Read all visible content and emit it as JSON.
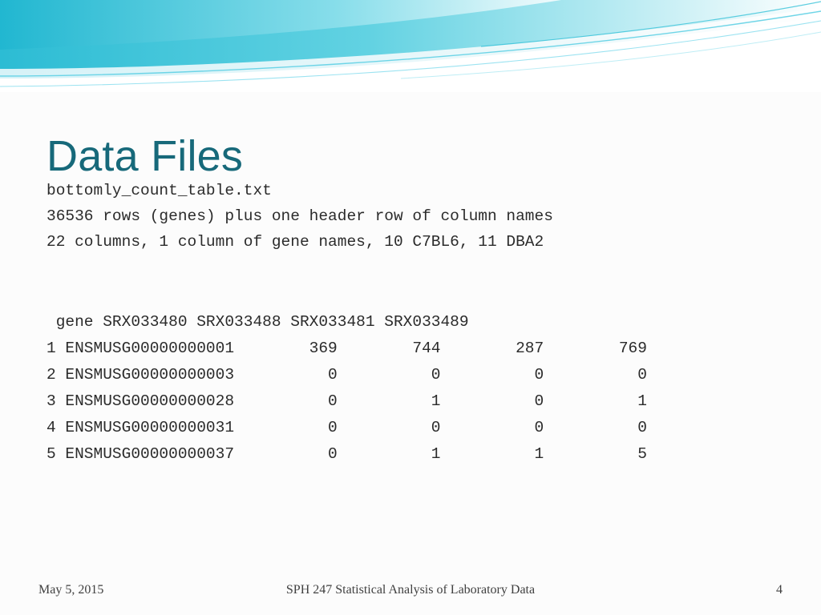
{
  "slide": {
    "title": "Data Files",
    "description_lines": [
      "bottomly_count_table.txt",
      "36536 rows (genes) plus one header row of column names",
      "22 columns, 1 column of gene names, 10 C7BL6, 11 DBA2"
    ],
    "table_text": " gene SRX033480 SRX033488 SRX033481 SRX033489\n1 ENSMUSG00000000001        369        744        287        769\n2 ENSMUSG00000000003          0          0          0          0\n3 ENSMUSG00000000028          0          1          0          1\n4 ENSMUSG00000000031          0          0          0          0\n5 ENSMUSG00000000037          0          1          1          5",
    "table": {
      "columns": [
        "gene",
        "SRX033480",
        "SRX033488",
        "SRX033481",
        "SRX033489"
      ],
      "rows": [
        {
          "index": "1",
          "gene": "ENSMUSG00000000001",
          "values": [
            "369",
            "744",
            "287",
            "769"
          ]
        },
        {
          "index": "2",
          "gene": "ENSMUSG00000000003",
          "values": [
            "0",
            "0",
            "0",
            "0"
          ]
        },
        {
          "index": "3",
          "gene": "ENSMUSG00000000028",
          "values": [
            "0",
            "1",
            "0",
            "1"
          ]
        },
        {
          "index": "4",
          "gene": "ENSMUSG00000000031",
          "values": [
            "0",
            "0",
            "0",
            "0"
          ]
        },
        {
          "index": "5",
          "gene": "ENSMUSG00000000037",
          "values": [
            "0",
            "1",
            "1",
            "5"
          ]
        }
      ]
    },
    "footer": {
      "date": "May 5, 2015",
      "center": "SPH 247 Statistical Analysis of Laboratory Data",
      "page": "4"
    },
    "colors": {
      "title": "#17697a",
      "banner_teal": "#3fc6da",
      "banner_light": "#d9f3f7",
      "text": "#2b2b2b"
    }
  }
}
